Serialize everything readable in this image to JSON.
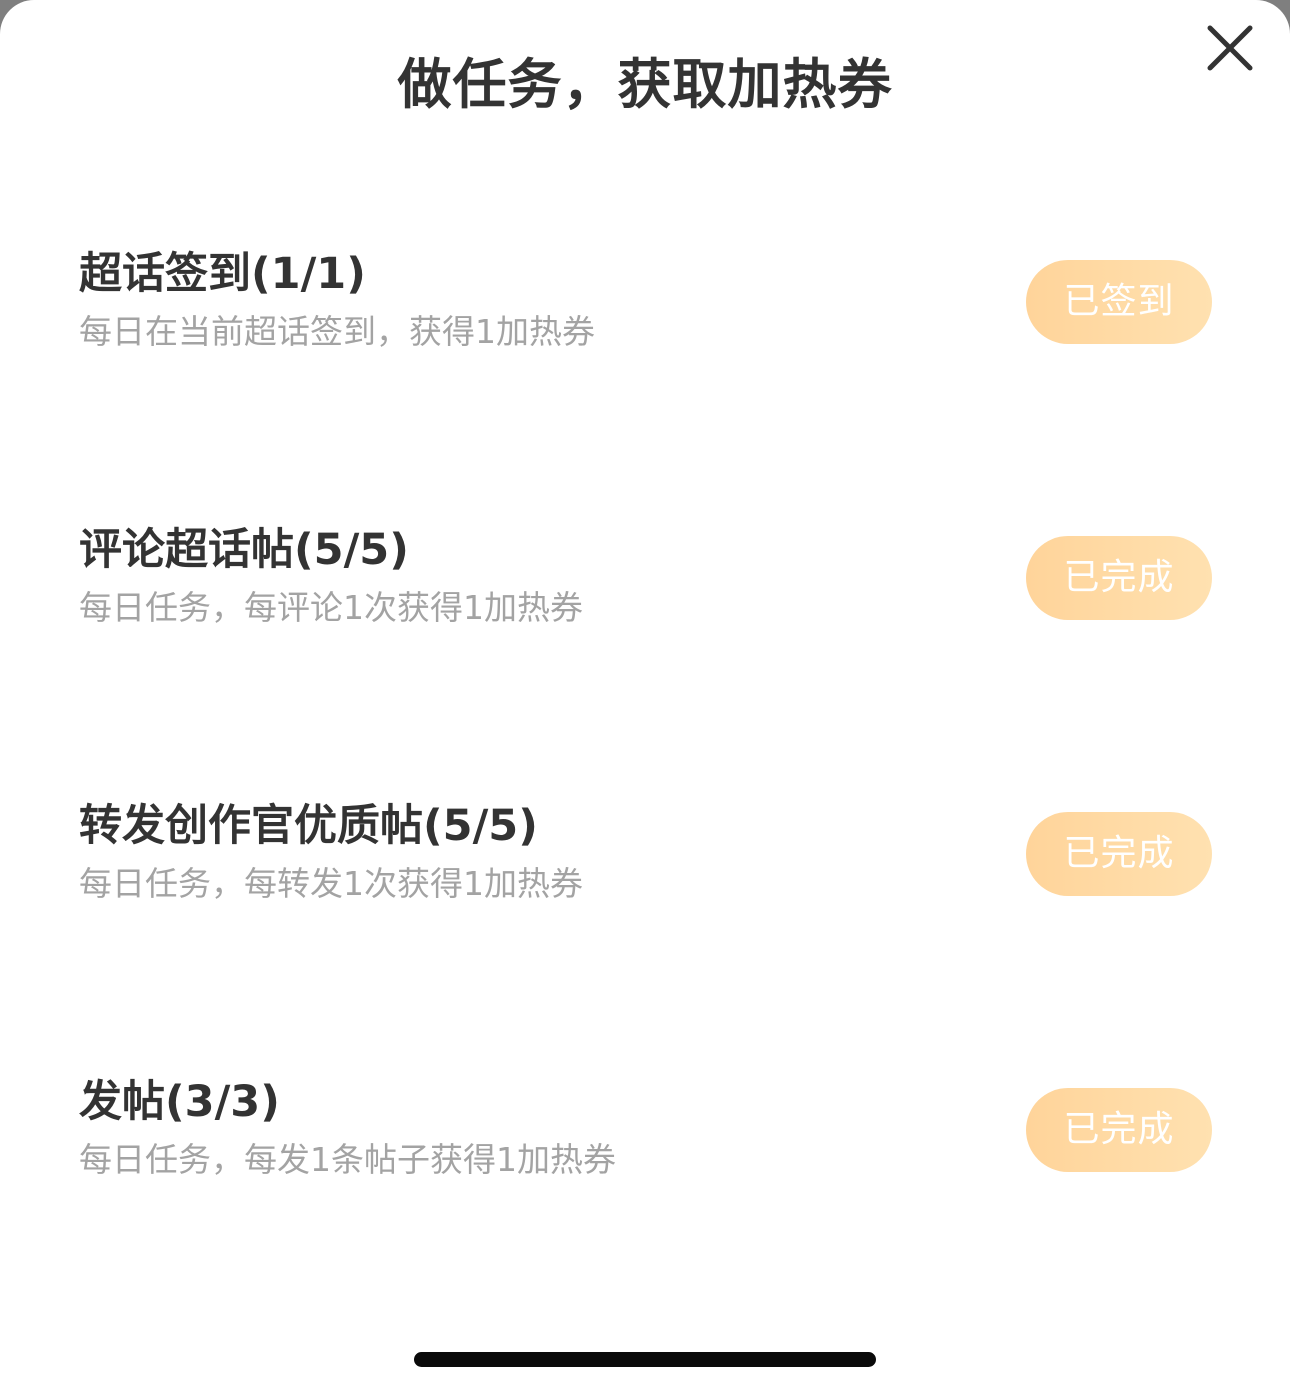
{
  "dialog": {
    "title": "做任务，获取加热券",
    "close_icon": "close-icon"
  },
  "tasks": [
    {
      "title": "超话签到(1/1)",
      "description": "每日在当前超话签到，获得1加热券",
      "button_label": "已签到"
    },
    {
      "title": "评论超话帖(5/5)",
      "description": "每日任务，每评论1次获得1加热券",
      "button_label": "已完成"
    },
    {
      "title": "转发创作官优质帖(5/5)",
      "description": "每日任务，每转发1次获得1加热券",
      "button_label": "已完成"
    },
    {
      "title": "发帖(3/3)",
      "description": "每日任务，每发1条帖子获得1加热券",
      "button_label": "已完成"
    }
  ],
  "colors": {
    "title_text": "#333333",
    "description_text": "#a3a3a3",
    "button_gradient_start": "#ffd49a",
    "button_gradient_end": "#ffe1b0",
    "button_text": "#ffffff"
  }
}
